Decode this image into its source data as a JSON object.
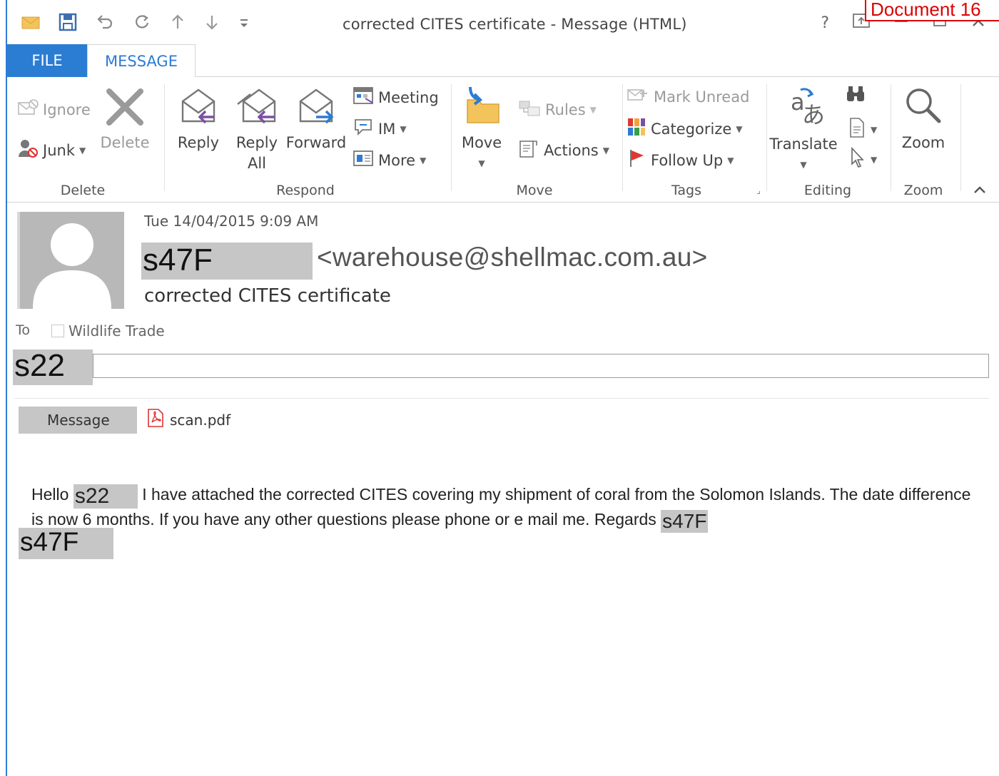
{
  "window": {
    "title": "corrected CITES certificate - Message (HTML)",
    "help": "?",
    "stamp": "Document 16"
  },
  "tabs": [
    {
      "label": "FILE"
    },
    {
      "label": "MESSAGE"
    }
  ],
  "ribbon": {
    "delete_group": {
      "label": "Delete",
      "ignore": "Ignore",
      "junk": "Junk",
      "delete": "Delete"
    },
    "respond_group": {
      "label": "Respond",
      "reply": "Reply",
      "reply_all_line1": "Reply",
      "reply_all_line2": "All",
      "forward": "Forward",
      "meeting": "Meeting",
      "im": "IM",
      "more": "More"
    },
    "move_group": {
      "label": "Move",
      "move": "Move",
      "rules": "Rules",
      "actions": "Actions"
    },
    "tags_group": {
      "label": "Tags",
      "mark_unread": "Mark Unread",
      "categorize": "Categorize",
      "follow_up": "Follow Up"
    },
    "editing_group": {
      "label": "Editing",
      "translate": "Translate"
    },
    "zoom_group": {
      "label": "Zoom",
      "zoom": "Zoom"
    }
  },
  "header": {
    "date": "Tue 14/04/2015 9:09 AM",
    "sender_redaction": "s47F",
    "sender_email": "<warehouse@shellmac.com.au>",
    "subject": "corrected CITES certificate",
    "to_label": "To",
    "to_value": "Wildlife Trade",
    "cc_redaction": "s22"
  },
  "attachments": {
    "message_tab": "Message",
    "file": "scan.pdf"
  },
  "body": {
    "greeting": "Hello",
    "greeting_redaction": "s22",
    "text": " I have attached the corrected CITES covering my shipment of coral from the Solomon Islands. The date difference is now 6 months. If you have any other questions please phone or e mail me. Regards",
    "regards_redaction": "s47F",
    "signature_redaction": "s47F"
  },
  "colors": {
    "accent": "#2b7cd3",
    "redaction": "#c6c6c6",
    "stamp": "#dd0000"
  }
}
